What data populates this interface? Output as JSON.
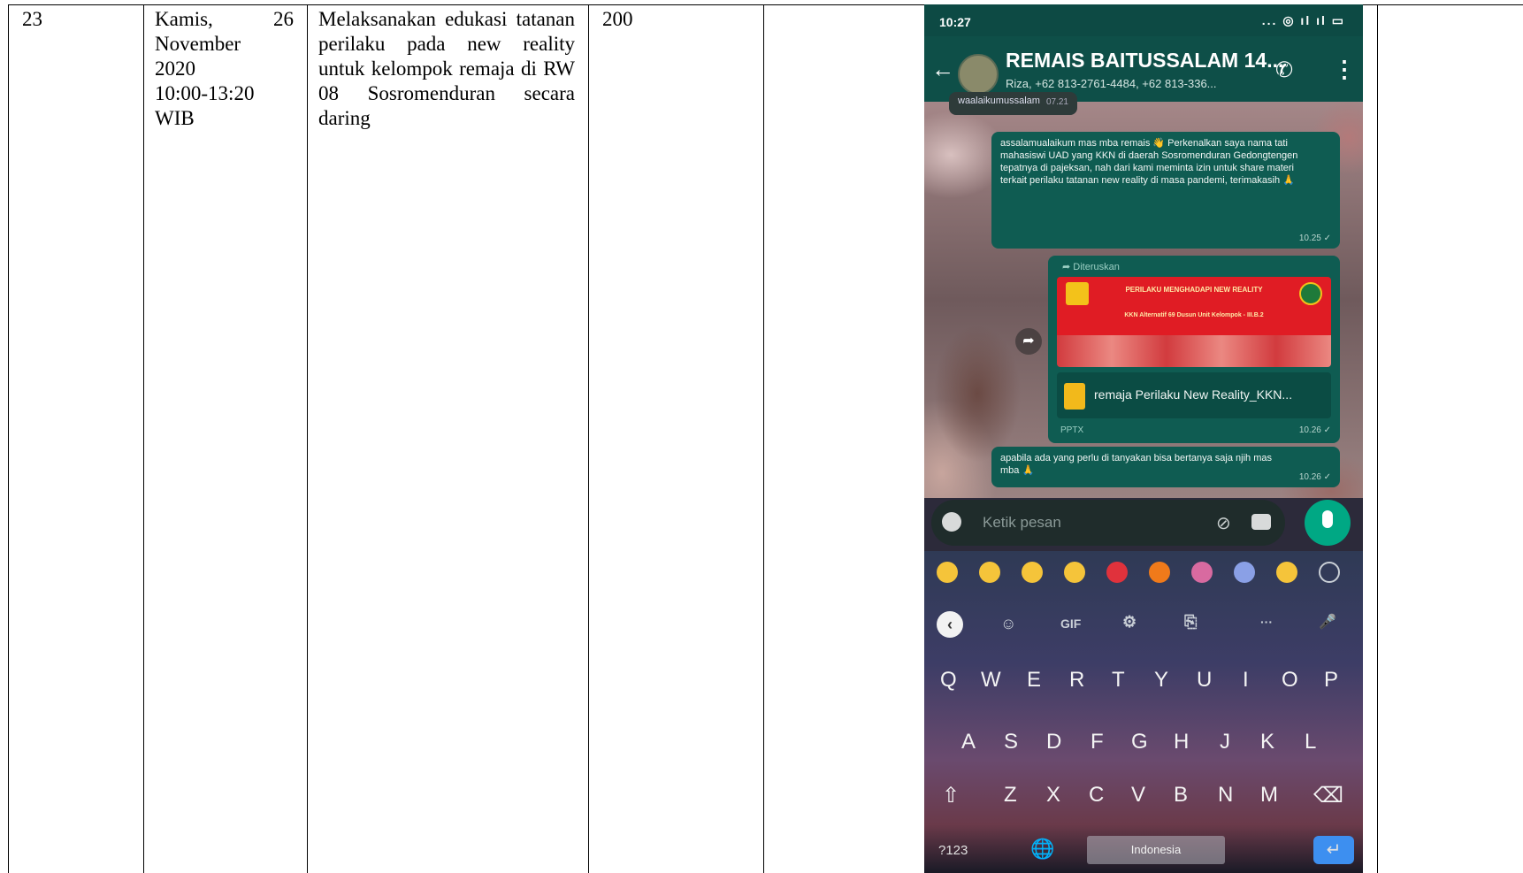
{
  "table": {
    "row": {
      "no": "23",
      "date_lines": [
        "Kamis,",
        "26",
        "November",
        "2020",
        "10:00-13:20",
        "WIB"
      ],
      "activity": "Melaksanakan edukasi tatanan perilaku pada new reality untuk kelompok remaja di RW 08 Sosromenduran secara daring",
      "participants": "200",
      "empty": ""
    }
  },
  "phone": {
    "status": {
      "time": "10:27",
      "icons": "... ◎ ıl ıl ▭"
    },
    "chat": {
      "title": "REMAIS BAITUSSALAM 14...",
      "subtitle": "Riza, +62 813-2761-4484, +62 813-336...",
      "prev_message": "waalaikumussalam",
      "prev_time": "07.21",
      "message1": "assalamualaikum mas mba remais 👋 Perkenalkan saya nama tati mahasiswi UAD yang KKN di daerah Sosromenduran Gedongtengen tepatnya di pajeksan, nah dari kami meminta izin untuk share materi terkait perilaku tatanan new reality di masa pandemi, terimakasih 🙏",
      "message1_time": "10.25 ✓",
      "forward_label": "➦ Diteruskan",
      "banner_title": "PERILAKU MENGHADAPI NEW REALITY",
      "banner_sub": "KKN Alternatif 69 Dusun Unit Kelompok - III.B.2",
      "file_name": "remaja Perilaku New Reality_KKN...",
      "file_type": "PPTX",
      "file_time": "10.26 ✓",
      "message2": "apabila ada yang perlu di tanyakan bisa bertanya saja njih mas mba 🙏",
      "message2_time": "10.26 ✓",
      "input_placeholder": "Ketik pesan"
    },
    "keyboard": {
      "tools": [
        "‹",
        "☺",
        "GIF",
        "⚙",
        "⎘",
        "···",
        "🎤"
      ],
      "row1": [
        "Q",
        "W",
        "E",
        "R",
        "T",
        "Y",
        "U",
        "I",
        "O",
        "P"
      ],
      "row2": [
        "A",
        "S",
        "D",
        "F",
        "G",
        "H",
        "J",
        "K",
        "L"
      ],
      "row3": [
        "⇧",
        "Z",
        "X",
        "C",
        "V",
        "B",
        "N",
        "M",
        "⌫"
      ],
      "numbers_key": "?123",
      "space_label": "Indonesia",
      "enter": "↵"
    },
    "colors": {
      "header": "#0e4f48",
      "bubble": "#0f5c52",
      "mic": "#00a884",
      "enter": "#3d8ff0"
    }
  }
}
